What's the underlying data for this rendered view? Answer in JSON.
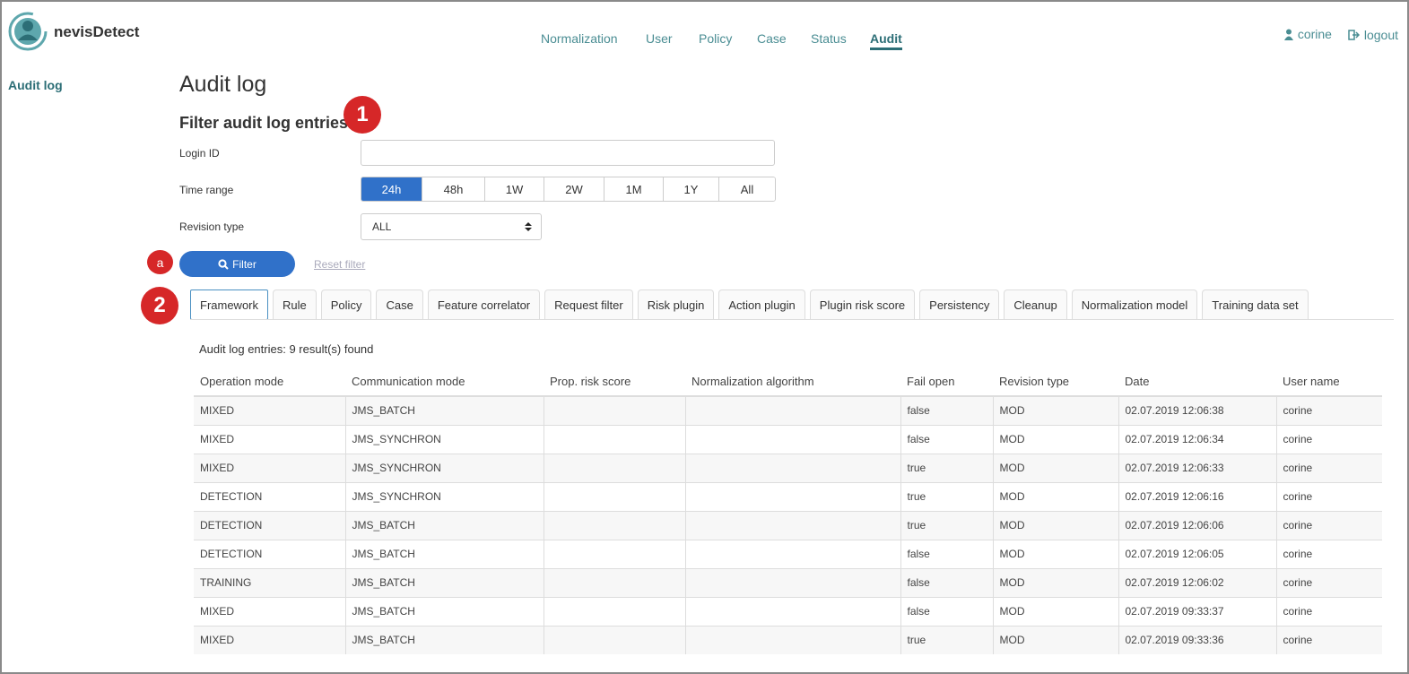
{
  "app": {
    "brand": "nevisDetect"
  },
  "nav": {
    "items": [
      "Normalization",
      "User",
      "Policy",
      "Case",
      "Status",
      "Audit"
    ],
    "active": "Audit"
  },
  "user": {
    "name": "corine",
    "logout": "logout"
  },
  "sidebar": {
    "link": "Audit log"
  },
  "page": {
    "title": "Audit log",
    "filter_title": "Filter audit log entries"
  },
  "markers": {
    "one": "1",
    "two": "2",
    "a": "a"
  },
  "form": {
    "login_label": "Login ID",
    "login_value": "",
    "range_label": "Time range",
    "ranges": [
      "24h",
      "48h",
      "1W",
      "2W",
      "1M",
      "1Y",
      "All"
    ],
    "range_selected": "24h",
    "revision_label": "Revision type",
    "revision_value": "ALL",
    "filter_button": "Filter",
    "reset_link": "Reset filter"
  },
  "tabs": [
    "Framework",
    "Rule",
    "Policy",
    "Case",
    "Feature correlator",
    "Request filter",
    "Risk plugin",
    "Action plugin",
    "Plugin risk score",
    "Persistency",
    "Cleanup",
    "Normalization model",
    "Training data set"
  ],
  "active_tab": "Framework",
  "results": {
    "summary": "Audit log entries: 9 result(s) found"
  },
  "table": {
    "headers": [
      "Operation mode",
      "Communication mode",
      "Prop. risk score",
      "Normalization algorithm",
      "Fail open",
      "Revision type",
      "Date",
      "User name"
    ],
    "rows": [
      [
        "MIXED",
        "JMS_BATCH",
        "",
        "",
        "false",
        "MOD",
        "02.07.2019 12:06:38",
        "corine"
      ],
      [
        "MIXED",
        "JMS_SYNCHRON",
        "",
        "",
        "false",
        "MOD",
        "02.07.2019 12:06:34",
        "corine"
      ],
      [
        "MIXED",
        "JMS_SYNCHRON",
        "",
        "",
        "true",
        "MOD",
        "02.07.2019 12:06:33",
        "corine"
      ],
      [
        "DETECTION",
        "JMS_SYNCHRON",
        "",
        "",
        "true",
        "MOD",
        "02.07.2019 12:06:16",
        "corine"
      ],
      [
        "DETECTION",
        "JMS_BATCH",
        "",
        "",
        "true",
        "MOD",
        "02.07.2019 12:06:06",
        "corine"
      ],
      [
        "DETECTION",
        "JMS_BATCH",
        "",
        "",
        "false",
        "MOD",
        "02.07.2019 12:06:05",
        "corine"
      ],
      [
        "TRAINING",
        "JMS_BATCH",
        "",
        "",
        "false",
        "MOD",
        "02.07.2019 12:06:02",
        "corine"
      ],
      [
        "MIXED",
        "JMS_BATCH",
        "",
        "",
        "false",
        "MOD",
        "02.07.2019 09:33:37",
        "corine"
      ],
      [
        "MIXED",
        "JMS_BATCH",
        "",
        "",
        "true",
        "MOD",
        "02.07.2019 09:33:36",
        "corine"
      ]
    ]
  },
  "colors": {
    "accent": "#3071c9",
    "brand": "#4a8d93",
    "marker": "#d62728"
  }
}
